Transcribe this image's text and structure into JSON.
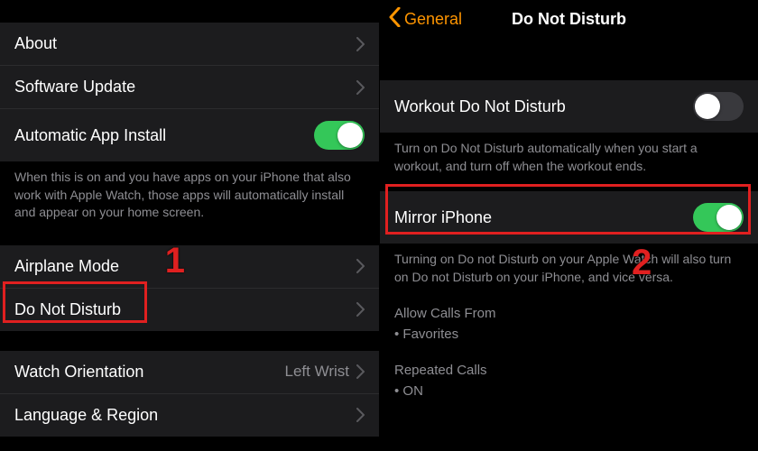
{
  "left": {
    "rows": {
      "about": "About",
      "software_update": "Software Update",
      "auto_install": "Automatic App Install",
      "auto_install_on": true,
      "footer": "When this is on and you have apps on your iPhone that also work with Apple Watch, those apps will automatically install and appear on your home screen.",
      "airplane": "Airplane Mode",
      "dnd": "Do Not Disturb",
      "watch_orient": "Watch Orientation",
      "watch_orient_val": "Left Wrist",
      "lang_region": "Language & Region"
    },
    "annotation_number": "1"
  },
  "right": {
    "back_label": "General",
    "title": "Do Not Disturb",
    "workout_label": "Workout Do Not Disturb",
    "workout_on": false,
    "workout_footer": "Turn on Do Not Disturb automatically when you start a workout, and turn off when the workout ends.",
    "mirror_label": "Mirror iPhone",
    "mirror_on": true,
    "mirror_footer": "Turning on Do not Disturb on your Apple Watch will also turn on Do not Disturb on your iPhone, and vice versa.",
    "allow_calls_head": "Allow Calls From",
    "allow_calls_val": "• Favorites",
    "repeated_head": "Repeated Calls",
    "repeated_val": "• ON",
    "annotation_number": "2"
  }
}
